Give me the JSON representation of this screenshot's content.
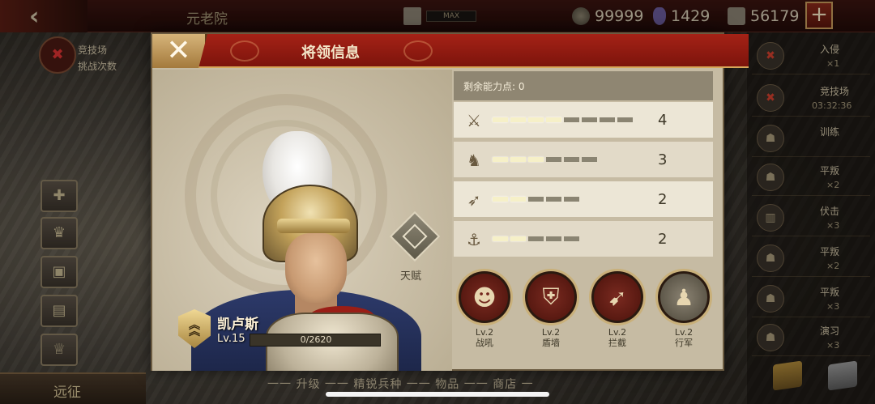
{
  "topbar": {
    "back_icon": "back-arrow-icon",
    "title": "元老院",
    "temple_level": "MAX",
    "gold": "99999",
    "gems": "1429",
    "food": "56179",
    "plus_label": "+"
  },
  "left_col": {
    "arena_line1": "竞技场",
    "arena_line2": "挑战次数",
    "expedition": "远征"
  },
  "bottom_tabs": "一一 升级 一一 精锐兵种 一一 物品 一一 商店 一",
  "right_col": {
    "items": [
      {
        "name": "入侵",
        "count": "×1"
      },
      {
        "name": "竞技场",
        "time": "03:32:36"
      },
      {
        "name": "训练",
        "count": ""
      },
      {
        "name": "平叛",
        "count": "×2"
      },
      {
        "name": "伏击",
        "count": "×3"
      },
      {
        "name": "平叛",
        "count": "×2"
      },
      {
        "name": "平叛",
        "count": "×3"
      },
      {
        "name": "演习",
        "count": "×3"
      }
    ]
  },
  "modal": {
    "title": "将领信息",
    "close_label": "✕",
    "hero": {
      "name": "凯卢斯",
      "level": "Lv.15",
      "xp_text": "0/2620",
      "xp_fraction": 0.0
    },
    "talent_label": "天赋",
    "points_label": "剩余能力点: 0",
    "attributes": [
      {
        "icon": "sword-icon",
        "glyph": "⚔",
        "value": "4",
        "pips_on": 4,
        "pips_total": 8
      },
      {
        "icon": "horse-icon",
        "glyph": "♞",
        "value": "3",
        "pips_on": 3,
        "pips_total": 6
      },
      {
        "icon": "bow-icon",
        "glyph": "➶",
        "value": "2",
        "pips_on": 2,
        "pips_total": 5
      },
      {
        "icon": "anchor-icon",
        "glyph": "⚓",
        "value": "2",
        "pips_on": 2,
        "pips_total": 5
      }
    ],
    "skills": [
      {
        "icon": "war-cry-icon",
        "glyph": "☻",
        "level": "Lv.2",
        "name": "战吼"
      },
      {
        "icon": "shield-wall-icon",
        "glyph": "⛨",
        "level": "Lv.2",
        "name": "盾墙"
      },
      {
        "icon": "intercept-icon",
        "glyph": "➹",
        "level": "Lv.2",
        "name": "拦截"
      },
      {
        "icon": "march-icon",
        "glyph": "♟",
        "level": "Lv.2",
        "name": "行军"
      }
    ]
  }
}
